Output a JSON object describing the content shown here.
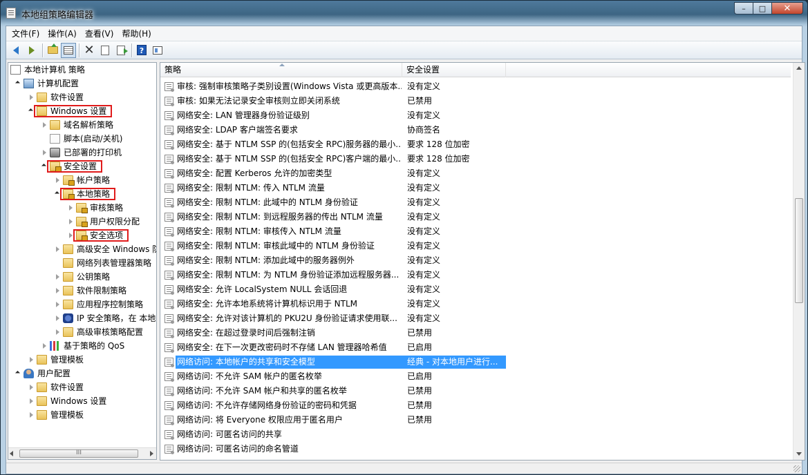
{
  "window": {
    "title": "本地组策略编辑器",
    "controls": {
      "minimize": "–",
      "maximize": "□",
      "close": "✕"
    }
  },
  "menu": [
    "文件(F)",
    "操作(A)",
    "查看(V)",
    "帮助(H)"
  ],
  "toolbar": [
    "back-icon",
    "forward-icon",
    "up-folder-icon",
    "show-tree-icon",
    "delete-icon",
    "properties-icon",
    "export-icon",
    "help-icon",
    "console-icon"
  ],
  "tree": [
    {
      "label": "本地计算机 策略",
      "level": 0,
      "icon": "policy-doc-icon",
      "toggle": "none"
    },
    {
      "label": "计算机配置",
      "level": 1,
      "icon": "computer-icon",
      "toggle": "open"
    },
    {
      "label": "软件设置",
      "level": 2,
      "icon": "folder-icon",
      "toggle": "closed"
    },
    {
      "label": "Windows 设置",
      "level": 2,
      "icon": "folder-icon",
      "toggle": "open",
      "highlight": true
    },
    {
      "label": "域名解析策略",
      "level": 3,
      "icon": "folder-icon",
      "toggle": "closed"
    },
    {
      "label": "脚本(启动/关机)",
      "level": 3,
      "icon": "script-icon",
      "toggle": "none"
    },
    {
      "label": "已部署的打印机",
      "level": 3,
      "icon": "printer-icon",
      "toggle": "closed"
    },
    {
      "label": "安全设置",
      "level": 3,
      "icon": "folder-lock-icon",
      "toggle": "open",
      "highlight": true
    },
    {
      "label": "帐户策略",
      "level": 4,
      "icon": "folder-lock-icon",
      "toggle": "closed"
    },
    {
      "label": "本地策略",
      "level": 4,
      "icon": "folder-lock-icon",
      "toggle": "open",
      "highlight": true
    },
    {
      "label": "审核策略",
      "level": 5,
      "icon": "folder-lock-icon",
      "toggle": "closed"
    },
    {
      "label": "用户权限分配",
      "level": 5,
      "icon": "folder-lock-icon",
      "toggle": "closed"
    },
    {
      "label": "安全选项",
      "level": 5,
      "icon": "folder-lock-icon",
      "toggle": "closed",
      "highlight": true
    },
    {
      "label": "高级安全 Windows 防",
      "level": 4,
      "icon": "folder-icon",
      "toggle": "closed"
    },
    {
      "label": "网络列表管理器策略",
      "level": 4,
      "icon": "folder-icon",
      "toggle": "none"
    },
    {
      "label": "公钥策略",
      "level": 4,
      "icon": "folder-icon",
      "toggle": "closed"
    },
    {
      "label": "软件限制策略",
      "level": 4,
      "icon": "folder-icon",
      "toggle": "closed"
    },
    {
      "label": "应用程序控制策略",
      "level": 4,
      "icon": "folder-icon",
      "toggle": "closed"
    },
    {
      "label": "IP 安全策略，在 本地",
      "level": 4,
      "icon": "ip-security-icon",
      "toggle": "closed"
    },
    {
      "label": "高级审核策略配置",
      "level": 4,
      "icon": "folder-icon",
      "toggle": "closed"
    },
    {
      "label": "基于策略的 QoS",
      "level": 3,
      "icon": "qos-chart-icon",
      "toggle": "closed"
    },
    {
      "label": "管理模板",
      "level": 2,
      "icon": "folder-icon",
      "toggle": "closed"
    },
    {
      "label": "用户配置",
      "level": 1,
      "icon": "user-icon",
      "toggle": "open"
    },
    {
      "label": "软件设置",
      "level": 2,
      "icon": "folder-icon",
      "toggle": "closed"
    },
    {
      "label": "Windows 设置",
      "level": 2,
      "icon": "folder-icon",
      "toggle": "closed"
    },
    {
      "label": "管理模板",
      "level": 2,
      "icon": "folder-icon",
      "toggle": "closed"
    }
  ],
  "left_scroll": {
    "thumb_grip": "III"
  },
  "list": {
    "columns": [
      "策略",
      "安全设置"
    ],
    "rows": [
      {
        "policy": "审核: 强制审核策略子类别设置(Windows Vista 或更高版本...",
        "setting": "没有定义"
      },
      {
        "policy": "审核: 如果无法记录安全审核则立即关闭系统",
        "setting": "已禁用"
      },
      {
        "policy": "网络安全: LAN 管理器身份验证级别",
        "setting": "没有定义"
      },
      {
        "policy": "网络安全: LDAP 客户端签名要求",
        "setting": "协商签名"
      },
      {
        "policy": "网络安全: 基于 NTLM SSP 的(包括安全 RPC)服务器的最小...",
        "setting": "要求 128 位加密"
      },
      {
        "policy": "网络安全: 基于 NTLM SSP 的(包括安全 RPC)客户端的最小...",
        "setting": "要求 128 位加密"
      },
      {
        "policy": "网络安全: 配置 Kerberos 允许的加密类型",
        "setting": "没有定义"
      },
      {
        "policy": "网络安全: 限制 NTLM: 传入 NTLM 流量",
        "setting": "没有定义"
      },
      {
        "policy": "网络安全: 限制 NTLM: 此域中的 NTLM 身份验证",
        "setting": "没有定义"
      },
      {
        "policy": "网络安全: 限制 NTLM: 到远程服务器的传出 NTLM 流量",
        "setting": "没有定义"
      },
      {
        "policy": "网络安全: 限制 NTLM: 审核传入 NTLM 流量",
        "setting": "没有定义"
      },
      {
        "policy": "网络安全: 限制 NTLM: 审核此域中的 NTLM 身份验证",
        "setting": "没有定义"
      },
      {
        "policy": "网络安全: 限制 NTLM: 添加此域中的服务器例外",
        "setting": "没有定义"
      },
      {
        "policy": "网络安全: 限制 NTLM: 为 NTLM 身份验证添加远程服务器...",
        "setting": "没有定义"
      },
      {
        "policy": "网络安全: 允许 LocalSystem NULL 会话回退",
        "setting": "没有定义"
      },
      {
        "policy": "网络安全: 允许本地系统将计算机标识用于 NTLM",
        "setting": "没有定义"
      },
      {
        "policy": "网络安全: 允许对该计算机的 PKU2U 身份验证请求使用联...",
        "setting": "没有定义"
      },
      {
        "policy": "网络安全: 在超过登录时间后强制注销",
        "setting": "已禁用"
      },
      {
        "policy": "网络安全: 在下一次更改密码时不存储 LAN 管理器哈希值",
        "setting": "已启用"
      },
      {
        "policy": "网络访问: 本地帐户的共享和安全模型",
        "setting": "经典 - 对本地用户进行...",
        "selected": true
      },
      {
        "policy": "网络访问: 不允许 SAM 帐户的匿名枚举",
        "setting": "已启用"
      },
      {
        "policy": "网络访问: 不允许 SAM 帐户和共享的匿名枚举",
        "setting": "已禁用"
      },
      {
        "policy": "网络访问: 不允许存储网络身份验证的密码和凭据",
        "setting": "已禁用"
      },
      {
        "policy": "网络访问: 将 Everyone 权限应用于匿名用户",
        "setting": "已禁用"
      },
      {
        "policy": "网络访问: 可匿名访问的共享",
        "setting": ""
      },
      {
        "policy": "网络访问: 可匿名访问的命名管道",
        "setting": ""
      }
    ]
  },
  "colors": {
    "selection": "#3399ff",
    "highlight_box": "#e01b1b"
  }
}
